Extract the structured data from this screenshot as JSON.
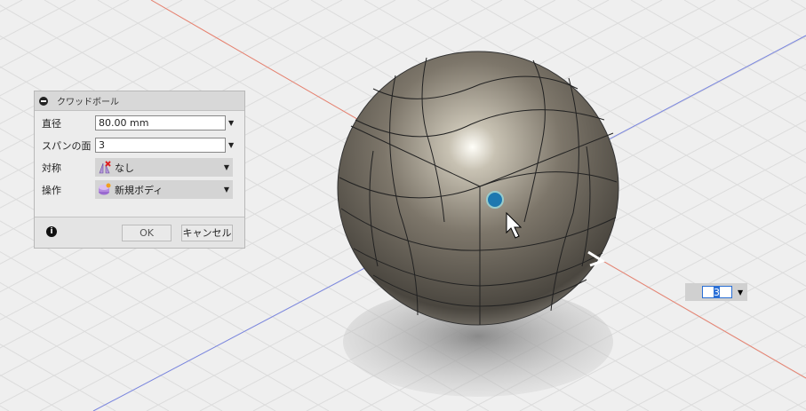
{
  "dialog": {
    "title": "クワッドボール",
    "fields": [
      {
        "label": "直径",
        "value": "80.00 mm"
      },
      {
        "label": "スパンの面",
        "value": "3"
      },
      {
        "label": "対称",
        "value": "なし"
      },
      {
        "label": "操作",
        "value": "新規ボディ"
      }
    ],
    "ok": "OK",
    "cancel": "キャンセル",
    "info": "i"
  },
  "span_input": {
    "value": "3"
  },
  "colors": {
    "x_axis": "#e8806e",
    "y_axis": "#7a86e0"
  }
}
